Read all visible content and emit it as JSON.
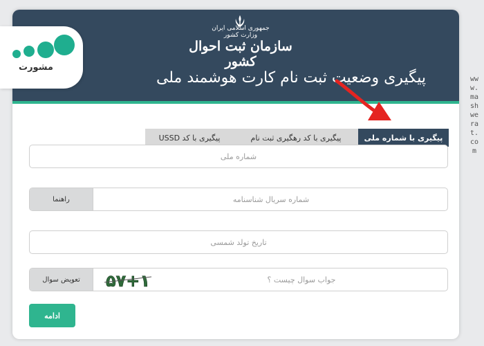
{
  "header": {
    "org_line1": "جمهوری اسلامی ایران",
    "org_line2": "وزارت کشور",
    "org_name": "سازمان ثبت احوال کشور",
    "page_title": "پیگیری وضعیت ثبت نام کارت هوشمند ملی"
  },
  "brand": {
    "text": "مشورت"
  },
  "watermark": {
    "text": "www.mashwerat.com"
  },
  "tabs": [
    {
      "label": "پیگیری با شماره ملی",
      "active": true
    },
    {
      "label": "پیگیری با کد رهگیری ثبت نام",
      "active": false
    },
    {
      "label": "پیگیری با کد USSD",
      "active": false
    }
  ],
  "form": {
    "national_code_placeholder": "شماره ملی",
    "serial_placeholder": "شماره سریال شناسنامه",
    "guide_label": "راهنما",
    "birth_date_placeholder": "تاریخ تولد شمسی",
    "captcha_placeholder": "جواب سوال چیست ؟",
    "captcha_text": "۵۷+۱",
    "change_question_label": "تعویض سوال",
    "submit_label": "ادامه"
  },
  "colors": {
    "header_bg": "#34495e",
    "accent": "#2fb58f",
    "arrow": "#e52421"
  }
}
